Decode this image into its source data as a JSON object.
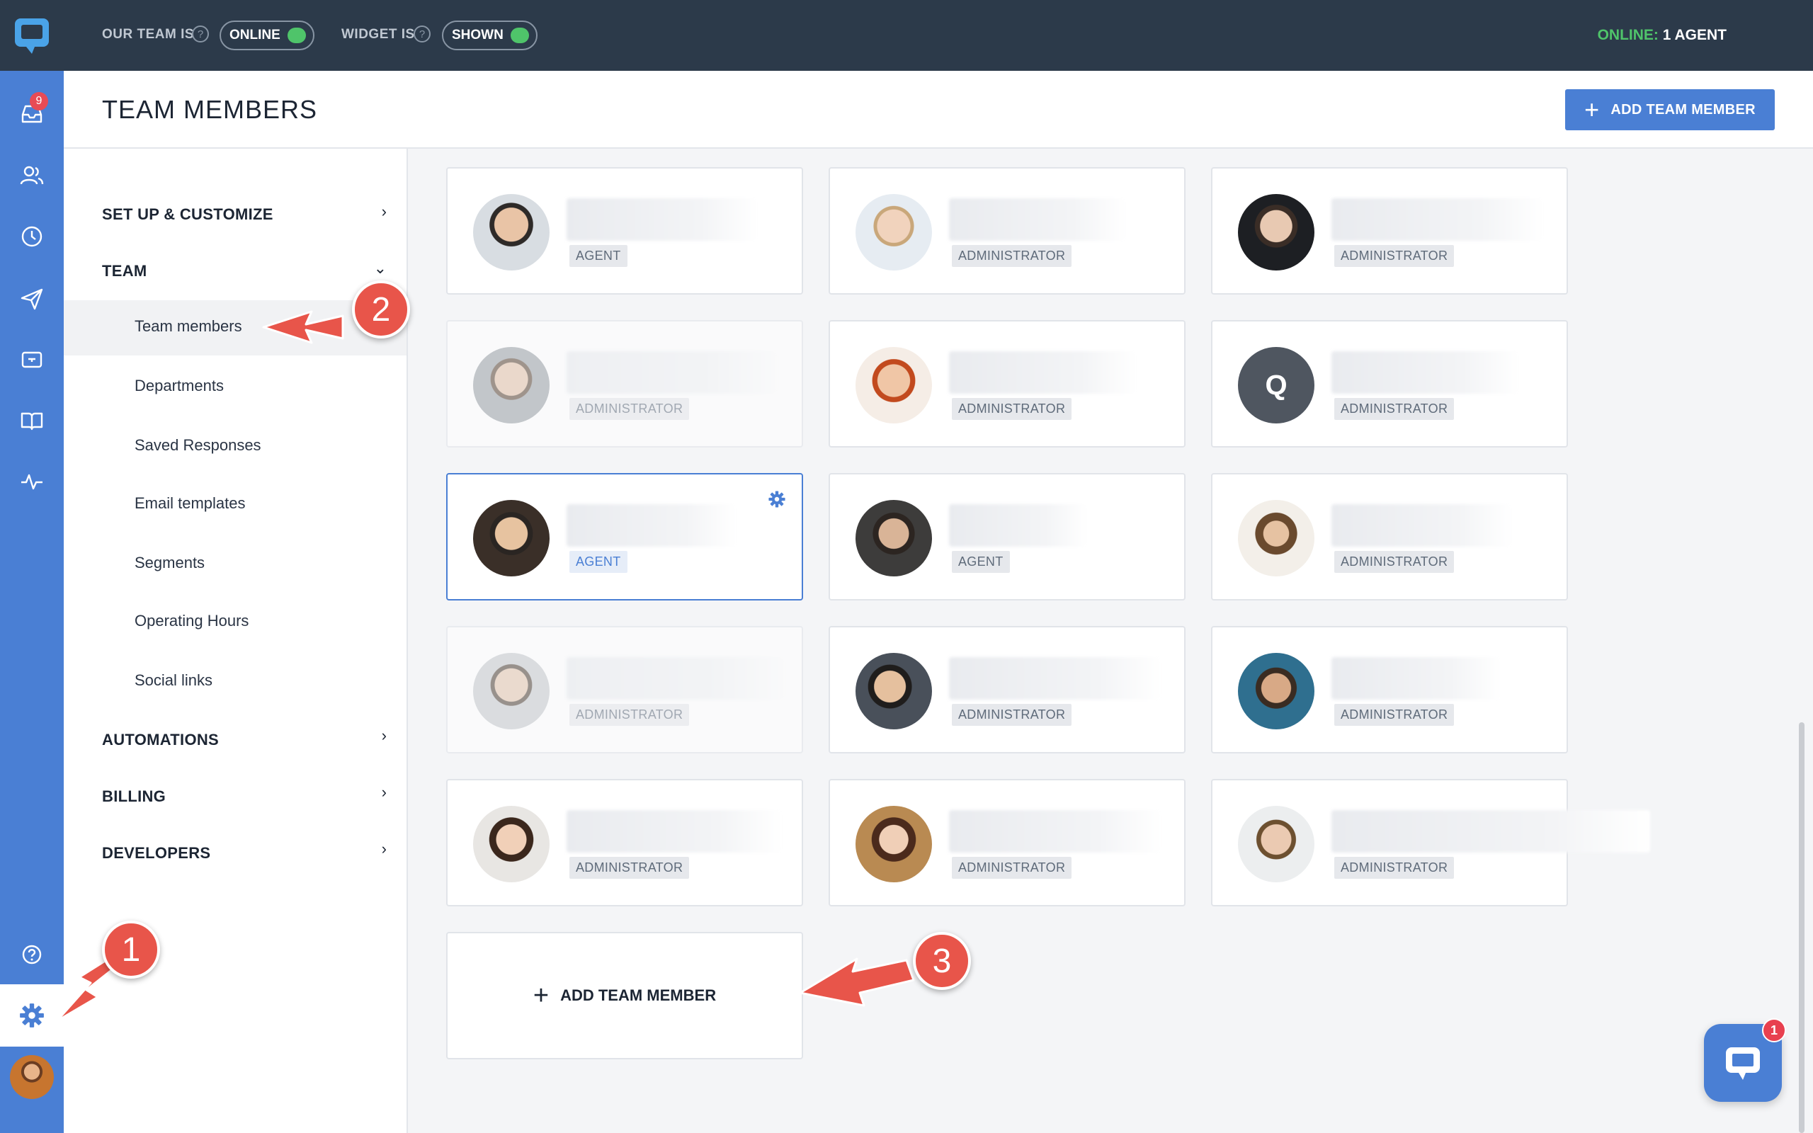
{
  "topbar": {
    "team_label": "OUR TEAM IS",
    "team_status": "ONLINE",
    "widget_label": "WIDGET IS",
    "widget_status": "SHOWN",
    "online_prefix": "ONLINE:",
    "online_value": "1 AGENT"
  },
  "rail": {
    "inbox_badge": "9",
    "icons": [
      "inbox-icon",
      "contacts-icon",
      "history-icon",
      "campaigns-icon",
      "widget-icon",
      "knowledge-base-icon",
      "analytics-icon",
      "help-icon",
      "settings-icon"
    ]
  },
  "header": {
    "title": "TEAM MEMBERS",
    "add_button": "ADD TEAM MEMBER"
  },
  "nav": {
    "setup": "SET UP & CUSTOMIZE",
    "team": "TEAM",
    "team_items": [
      "Team members",
      "Departments",
      "Saved Responses",
      "Email templates",
      "Segments",
      "Operating Hours",
      "Social links"
    ],
    "automations": "AUTOMATIONS",
    "billing": "BILLING",
    "developers": "DEVELOPERS"
  },
  "members": [
    {
      "role": "AGENT",
      "dim": false,
      "selected": false
    },
    {
      "role": "ADMINISTRATOR",
      "dim": false,
      "selected": false
    },
    {
      "role": "ADMINISTRATOR",
      "dim": false,
      "selected": false
    },
    {
      "role": "ADMINISTRATOR",
      "dim": true,
      "selected": false
    },
    {
      "role": "ADMINISTRATOR",
      "dim": false,
      "selected": false
    },
    {
      "role": "ADMINISTRATOR",
      "dim": false,
      "selected": false,
      "initial": "Q"
    },
    {
      "role": "AGENT",
      "dim": false,
      "selected": true
    },
    {
      "role": "AGENT",
      "dim": false,
      "selected": false
    },
    {
      "role": "ADMINISTRATOR",
      "dim": false,
      "selected": false
    },
    {
      "role": "ADMINISTRATOR",
      "dim": true,
      "selected": false
    },
    {
      "role": "ADMINISTRATOR",
      "dim": false,
      "selected": false
    },
    {
      "role": "ADMINISTRATOR",
      "dim": false,
      "selected": false
    },
    {
      "role": "ADMINISTRATOR",
      "dim": false,
      "selected": false
    },
    {
      "role": "ADMINISTRATOR",
      "dim": false,
      "selected": false
    },
    {
      "role": "ADMINISTRATOR",
      "dim": false,
      "selected": false
    }
  ],
  "add_card_label": "ADD TEAM MEMBER",
  "callouts": [
    "1",
    "2",
    "3"
  ],
  "chat": {
    "badge": "1"
  },
  "colors": {
    "accent": "#4a7fd4",
    "topbar": "#2c3a4a",
    "online": "#4fc46a",
    "callout": "#e8554a"
  }
}
